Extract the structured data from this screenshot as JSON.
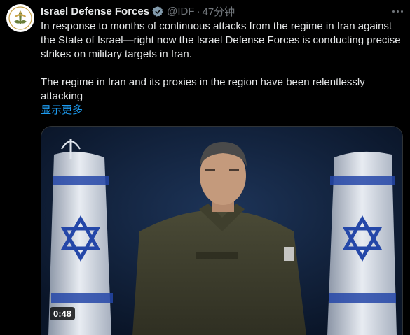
{
  "author": {
    "display_name": "Israel Defense Forces",
    "handle": "@IDF",
    "separator": "·",
    "time": "47分钟",
    "verified_badge": "verified-badge-icon",
    "avatar_icon": "idf-logo-icon"
  },
  "tweet": {
    "paragraph1": "In response to months of continuous attacks from the regime in Iran against the State of Israel—right now the Israel Defense Forces is conducting precise strikes on military targets in Iran.",
    "paragraph2": "The regime in Iran and its proxies in the region have been relentlessly attacking",
    "show_more": "显示更多"
  },
  "media": {
    "type": "video",
    "duration": "0:48",
    "background_color": "#0e1c33"
  },
  "colors": {
    "background": "#000000",
    "text": "#e7e9ea",
    "muted": "#71767b",
    "link": "#1d9bf0",
    "badge_gray": "#829aab"
  }
}
